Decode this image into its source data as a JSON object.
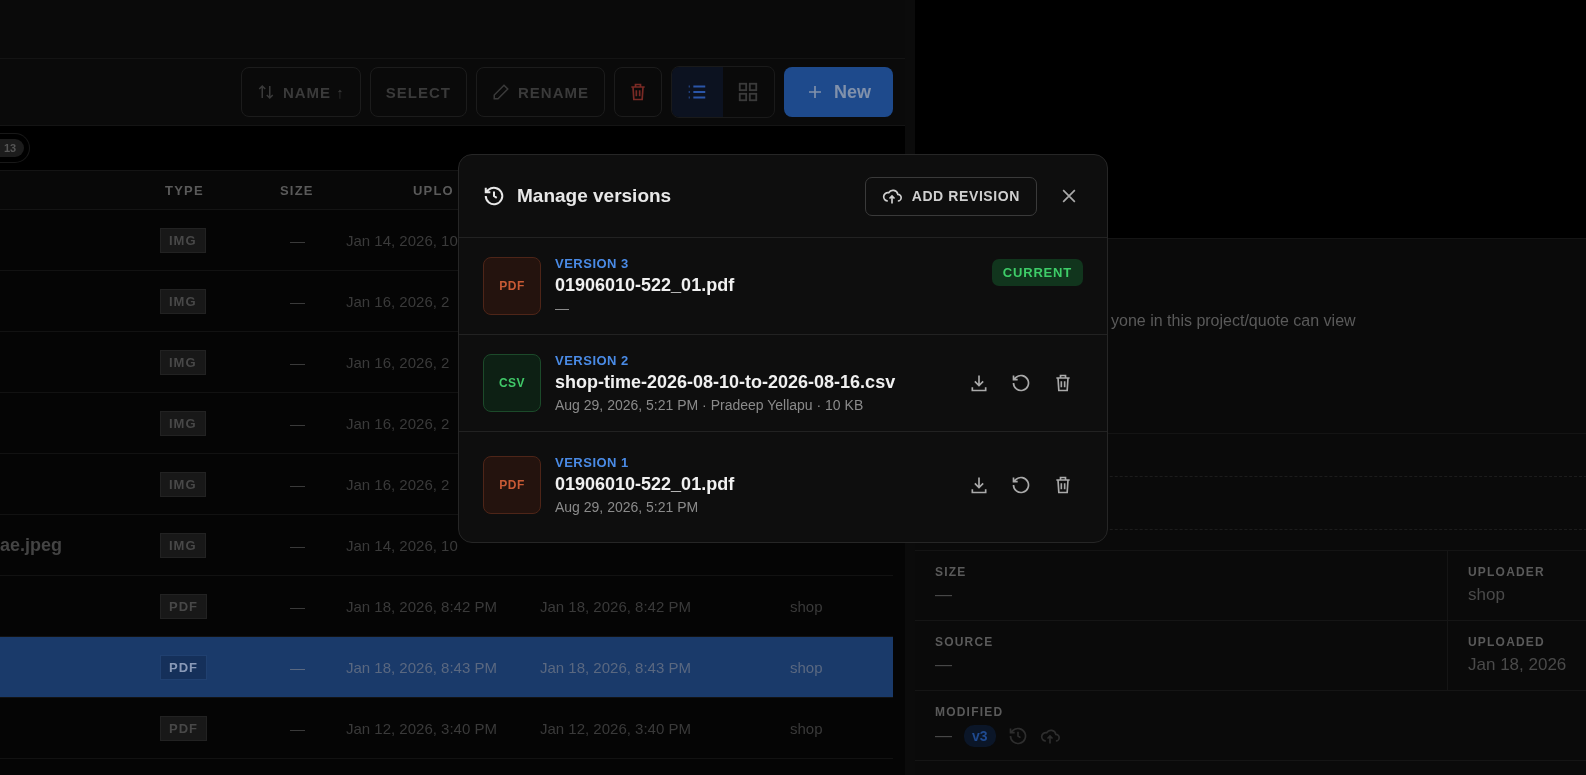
{
  "toolbar": {
    "sort_button": "NAME ↑",
    "select_button": "SELECT",
    "rename_button": "RENAME",
    "view_toggle": [
      {
        "kind": "list",
        "selected": true
      },
      {
        "kind": "grid",
        "selected": false
      }
    ],
    "new_button": "New"
  },
  "count_badge": "13",
  "table": {
    "columns": [
      "TYPE",
      "SIZE",
      "UPLO"
    ],
    "rows": [
      {
        "type": "IMG",
        "size": "—",
        "uploaded": "Jan 14, 2026, 10",
        "selected": false
      },
      {
        "type": "IMG",
        "size": "—",
        "uploaded": "Jan 16, 2026, 2",
        "selected": false
      },
      {
        "type": "IMG",
        "size": "—",
        "uploaded": "Jan 16, 2026, 2",
        "selected": false
      },
      {
        "type": "IMG",
        "size": "—",
        "uploaded": "Jan 16, 2026, 2",
        "selected": false
      },
      {
        "type": "IMG",
        "size": "—",
        "uploaded": "Jan 16, 2026, 2",
        "selected": false
      },
      {
        "name": "ae.jpeg",
        "type": "IMG",
        "size": "—",
        "uploaded": "Jan 14, 2026, 10",
        "selected": false
      },
      {
        "type": "PDF",
        "size": "—",
        "uploaded": "Jan 18, 2026, 8:42 PM",
        "modified": "Jan 18, 2026, 8:42 PM",
        "uploader": "shop",
        "selected": false
      },
      {
        "type": "PDF",
        "size": "—",
        "uploaded": "Jan 18, 2026, 8:43 PM",
        "modified": "Jan 18, 2026, 8:43 PM",
        "uploader": "shop",
        "selected": true
      },
      {
        "type": "PDF",
        "size": "—",
        "uploaded": "Jan 12, 2026, 3:40 PM",
        "modified": "Jan 12, 2026, 3:40 PM",
        "uploader": "shop",
        "selected": false
      }
    ]
  },
  "details": {
    "access_note": "yone in this project/quote can view",
    "fields": [
      {
        "label": "SIZE",
        "value": "—"
      },
      {
        "label": "UPLOADER",
        "value": "shop"
      },
      {
        "label": "SOURCE",
        "value": "—"
      },
      {
        "label": "UPLOADED",
        "value": "Jan 18, 2026"
      }
    ],
    "modified": {
      "label": "MODIFIED",
      "value": "—",
      "version_badge": "v3"
    }
  },
  "modal": {
    "title": "Manage versions",
    "add_button": "ADD REVISION",
    "versions": [
      {
        "kind": "pdf",
        "badge": "PDF",
        "label": "VERSION 3",
        "filename": "01906010-522_01.pdf",
        "meta": "—",
        "current": true,
        "status": "CURRENT"
      },
      {
        "kind": "csv",
        "badge": "CSV",
        "label": "VERSION 2",
        "filename": "shop-time-2026-08-10-to-2026-08-16.csv",
        "meta": "Aug 29, 2026, 5:21 PM · Pradeep Yellapu · 10 KB",
        "current": false
      },
      {
        "kind": "pdf",
        "badge": "PDF",
        "label": "VERSION 1",
        "filename": "01906010-522_01.pdf",
        "meta": "Aug 29, 2026, 5:21 PM",
        "current": false
      }
    ]
  }
}
